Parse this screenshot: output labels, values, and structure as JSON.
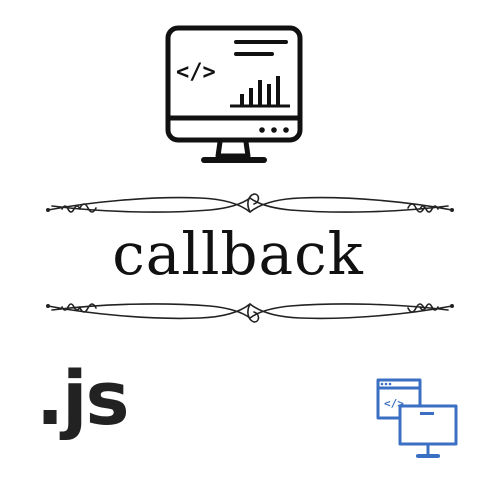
{
  "title": "callback",
  "js_label": ".js",
  "icons": {
    "monitor": "monitor-code-chart-icon",
    "browser_monitor": "browser-code-monitor-icon",
    "code_glyph": "</>"
  },
  "colors": {
    "ink": "#111111",
    "accent_blue": "#3a6fc4"
  }
}
